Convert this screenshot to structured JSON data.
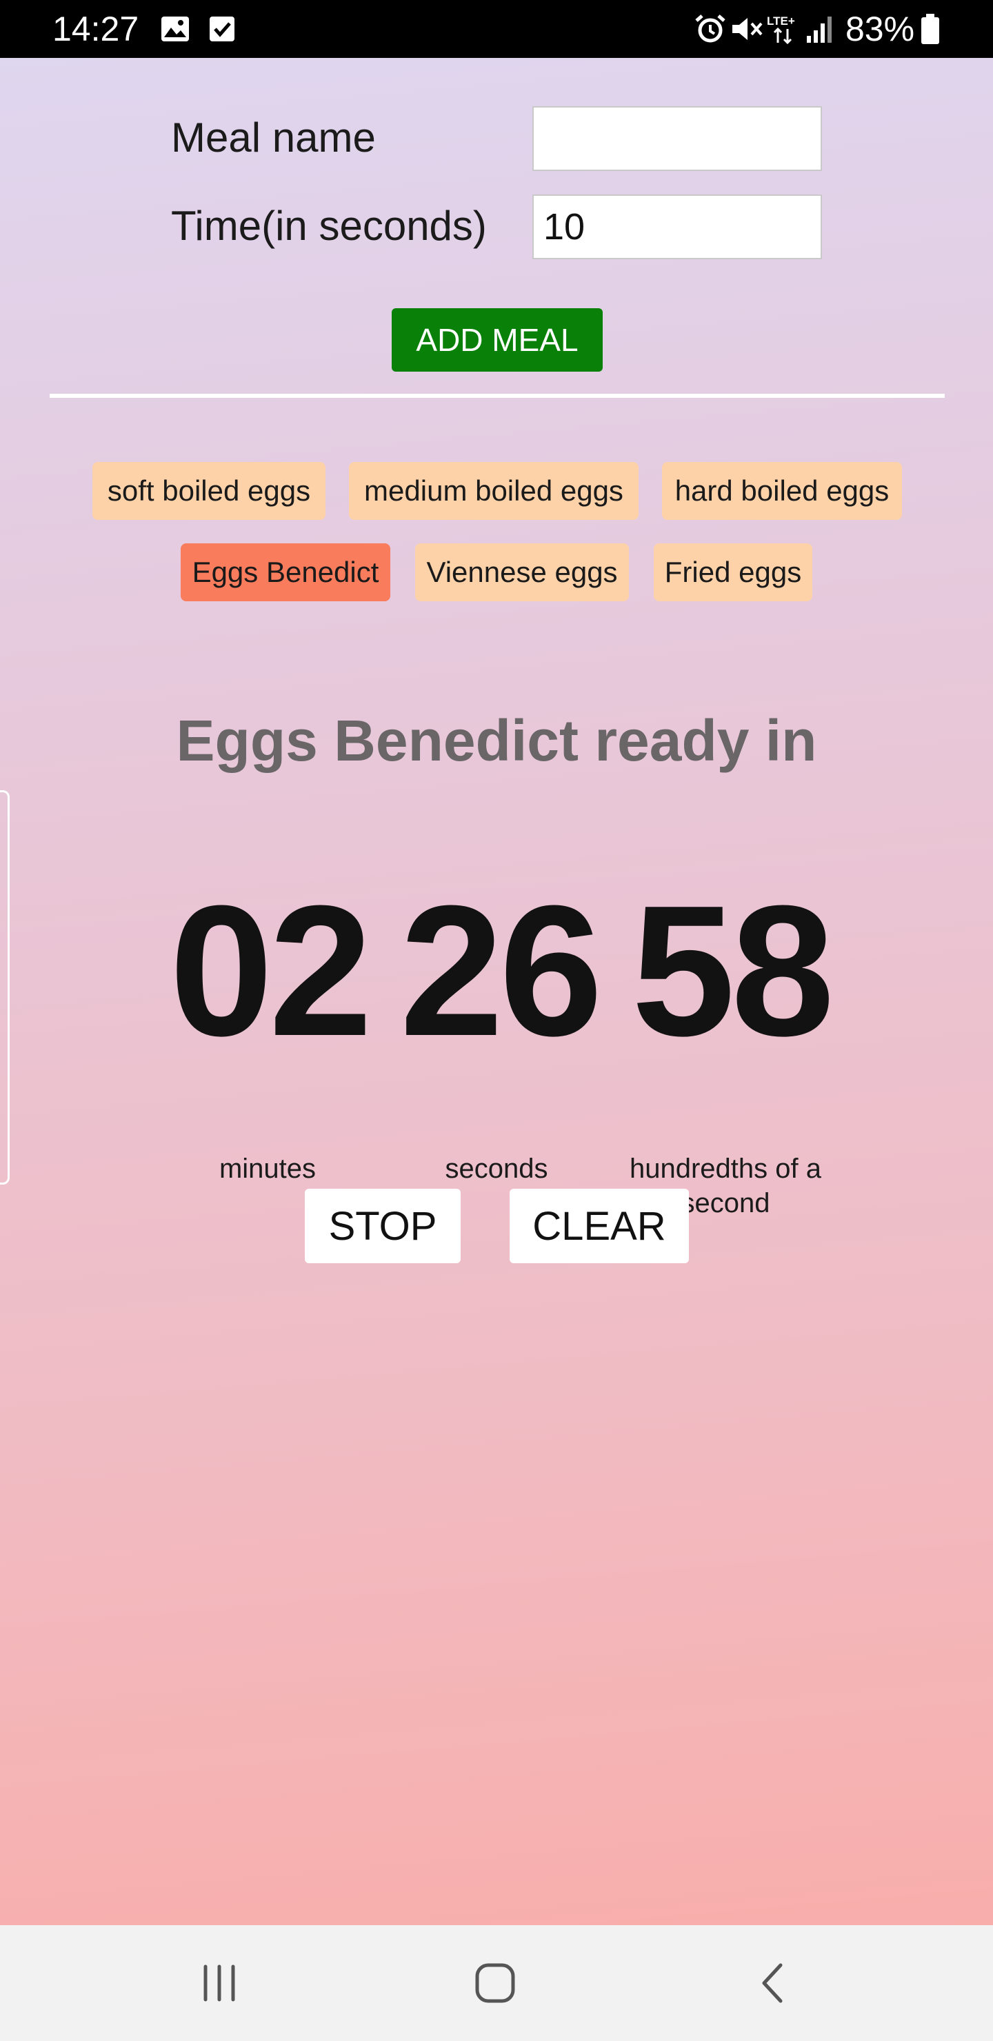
{
  "status_bar": {
    "time": "14:27",
    "battery_text": "83%",
    "icons": [
      "gallery-icon",
      "check-icon",
      "alarm-icon",
      "mute-icon",
      "lte-icon",
      "signal-icon",
      "battery-icon"
    ]
  },
  "form": {
    "meal_label": "Meal name",
    "meal_value": "",
    "time_label": "Time(in seconds)",
    "time_value": "10",
    "add_button": "ADD MEAL"
  },
  "meals": [
    {
      "label": "soft boiled eggs",
      "active": false
    },
    {
      "label": "medium boiled eggs",
      "active": false
    },
    {
      "label": "hard boiled eggs",
      "active": false
    },
    {
      "label": "Eggs Benedict",
      "active": true
    },
    {
      "label": "Viennese eggs",
      "active": false
    },
    {
      "label": "Fried eggs",
      "active": false
    }
  ],
  "timer": {
    "title": "Eggs Benedict ready in",
    "minutes": "02",
    "seconds": "26",
    "hundredths": "58",
    "minutes_label": "minutes",
    "seconds_label": "seconds",
    "hundredths_label": "hundredths of a second",
    "stop_button": "STOP",
    "clear_button": "CLEAR"
  },
  "colors": {
    "add_button": "#098109",
    "chip": "#fdd2a8",
    "chip_active": "#f97c5d"
  },
  "nav_bar": {
    "icons": [
      "recent-apps-icon",
      "home-icon",
      "back-icon"
    ]
  }
}
